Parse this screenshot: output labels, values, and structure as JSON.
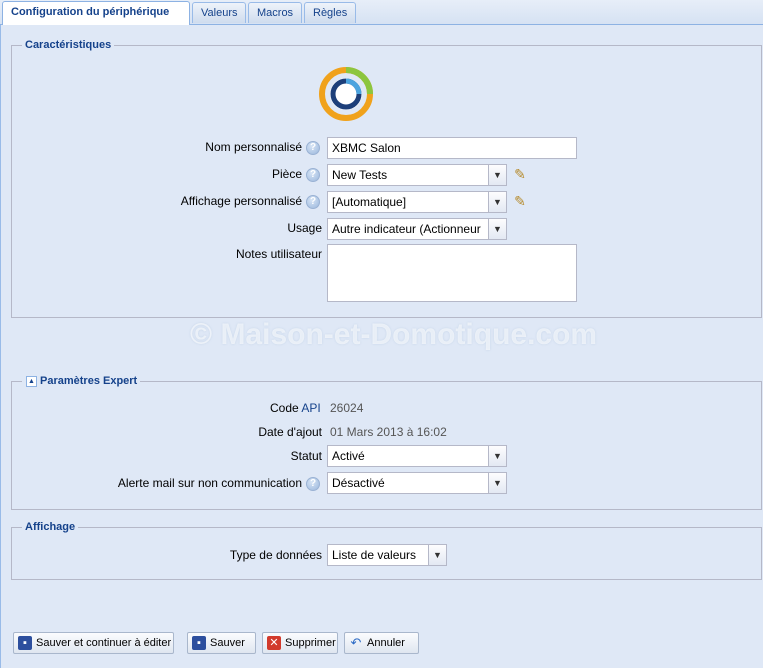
{
  "tabs": [
    {
      "label": "Configuration du périphérique"
    },
    {
      "label": "Valeurs"
    },
    {
      "label": "Macros"
    },
    {
      "label": "Règles"
    }
  ],
  "characteristics": {
    "legend": "Caractéristiques",
    "name_label": "Nom personnalisé",
    "name_value": "XBMC Salon",
    "room_label": "Pièce",
    "room_value": "New Tests",
    "display_label": "Affichage personnalisé",
    "display_value": "[Automatique]",
    "usage_label": "Usage",
    "usage_value": "Autre indicateur (Actionneur",
    "notes_label": "Notes utilisateur",
    "notes_value": ""
  },
  "expert": {
    "legend": "Paramètres Expert",
    "code_label": "Code",
    "code_link": "API",
    "code_value": "26024",
    "date_label": "Date d'ajout",
    "date_value": "01 Mars 2013 à 16:02",
    "status_label": "Statut",
    "status_value": "Activé",
    "mail_alert_label": "Alerte mail sur non communication",
    "mail_alert_value": "Désactivé"
  },
  "display": {
    "legend": "Affichage",
    "data_type_label": "Type de données",
    "data_type_value": "Liste de valeurs"
  },
  "buttons": {
    "save_continue": "Sauver et continuer à éditer",
    "save": "Sauver",
    "delete": "Supprimer",
    "cancel": "Annuler"
  },
  "watermark": "© Maison-et-Domotique.com",
  "colors": {
    "accent": "#15428b",
    "panel_bg": "#dfe8f6",
    "border": "#99bbe8"
  }
}
